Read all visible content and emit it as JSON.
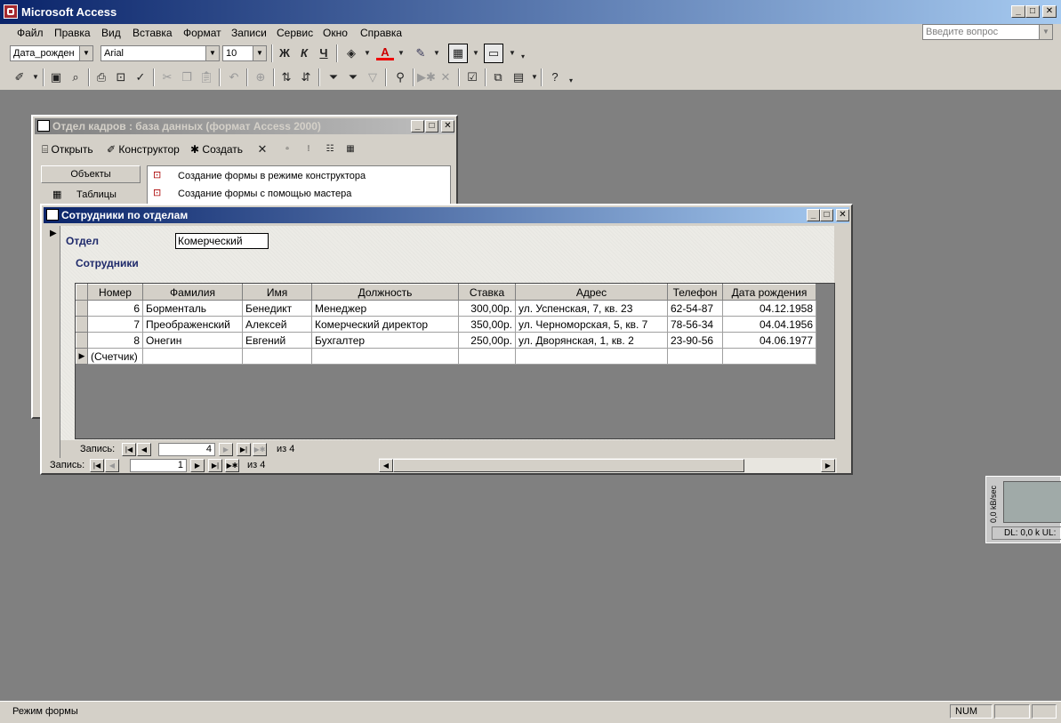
{
  "app": {
    "title": "Microsoft Access"
  },
  "menu": {
    "items": [
      "Файл",
      "Правка",
      "Вид",
      "Вставка",
      "Формат",
      "Записи",
      "Сервис",
      "Окно",
      "Справка"
    ],
    "help_placeholder": "Введите вопрос"
  },
  "format_toolbar": {
    "field": "Дата_рожден",
    "font": "Arial",
    "size": "10",
    "bold": "Ж",
    "italic": "К",
    "underline": "Ч"
  },
  "db_window": {
    "title": "Отдел кадров : база данных (формат Access 2000)",
    "open_label": "Открыть",
    "design_label": "Конструктор",
    "create_label": "Создать",
    "objects_header": "Объекты",
    "tables_label": "Таблицы",
    "list": [
      "Создание формы в режиме конструктора",
      "Создание формы с помощью мастера"
    ]
  },
  "form": {
    "title": "Сотрудники по отделам",
    "dept_label": "Отдел",
    "dept_value": "Комерческий",
    "sub_label": "Сотрудники",
    "columns": [
      "Номер",
      "Фамилия",
      "Имя",
      "Должность",
      "Ставка",
      "Адрес",
      "Телефон",
      "Дата рождения"
    ],
    "rows": [
      [
        "6",
        "Борменталь",
        "Бенедикт",
        "Менеджер",
        "300,00р.",
        "ул. Успенская, 7, кв. 23",
        "62-54-87",
        "04.12.1958"
      ],
      [
        "7",
        "Преображенский",
        "Алексей",
        "Комерческий директор",
        "350,00р.",
        "ул. Черноморская, 5, кв. 7",
        "78-56-34",
        "04.04.1956"
      ],
      [
        "8",
        "Онегин",
        "Евгений",
        "Бухгалтер",
        "250,00р.",
        "ул. Дворянская, 1, кв. 2",
        "23-90-56",
        "04.06.1977"
      ]
    ],
    "new_row": "(Счетчик)",
    "sub_nav": {
      "label": "Запись:",
      "current": "4",
      "of": "из 4"
    },
    "main_nav": {
      "label": "Запись:",
      "current": "1",
      "of": "из 4"
    }
  },
  "meter": {
    "axis": "0,0 kB/sec",
    "readout": "DL: 0,0 k  UL:"
  },
  "status": {
    "left": "Режим формы",
    "num": "NUM"
  }
}
